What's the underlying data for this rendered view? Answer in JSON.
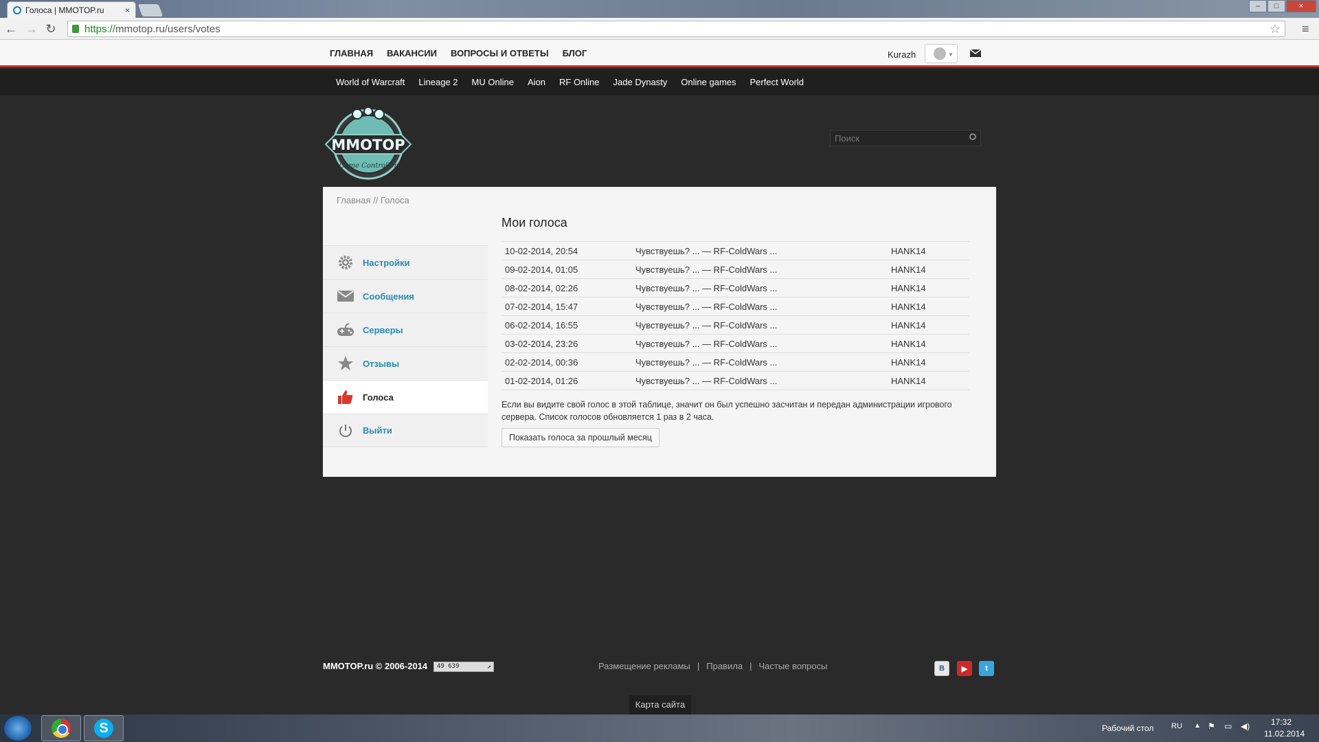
{
  "browser": {
    "tab_title": "Голоса | MMOTOP.ru",
    "tab_close": "×",
    "url_scheme": "https://",
    "url_rest": "mmotop.ru/users/votes"
  },
  "topnav": {
    "items": [
      "ГЛАВНАЯ",
      "ВАКАНСИИ",
      "ВОПРОСЫ И ОТВЕТЫ",
      "БЛОГ"
    ],
    "username": "Kurazh"
  },
  "gamenav": {
    "items": [
      "World of Warcraft",
      "Lineage 2",
      "MU Online",
      "Aion",
      "RF Online",
      "Jade Dynasty",
      "Online games",
      "Perfect World"
    ]
  },
  "logo": {
    "text": "MMOTOP",
    "subtitle": "Game Controller"
  },
  "search": {
    "placeholder": "Поиск"
  },
  "breadcrumb": "Главная // Голоса",
  "sidebar": {
    "items": [
      {
        "label": "Настройки",
        "icon": "gear-icon"
      },
      {
        "label": "Сообщения",
        "icon": "envelope-icon"
      },
      {
        "label": "Серверы",
        "icon": "gamepad-icon"
      },
      {
        "label": "Отзывы",
        "icon": "star-icon"
      },
      {
        "label": "Голоса",
        "icon": "thumbs-up-icon"
      },
      {
        "label": "Выйти",
        "icon": "power-icon"
      }
    ]
  },
  "main": {
    "title": "Мои голоса",
    "votes": [
      {
        "date": "10-02-2014, 20:54",
        "server": "Чувствуешь? ... — RF-ColdWars ...",
        "user": "HANK14"
      },
      {
        "date": "09-02-2014, 01:05",
        "server": "Чувствуешь? ... — RF-ColdWars ...",
        "user": "HANK14"
      },
      {
        "date": "08-02-2014, 02:26",
        "server": "Чувствуешь? ... — RF-ColdWars ...",
        "user": "HANK14"
      },
      {
        "date": "07-02-2014, 15:47",
        "server": "Чувствуешь? ... — RF-ColdWars ...",
        "user": "HANK14"
      },
      {
        "date": "06-02-2014, 16:55",
        "server": "Чувствуешь? ... — RF-ColdWars ...",
        "user": "HANK14"
      },
      {
        "date": "03-02-2014, 23:26",
        "server": "Чувствуешь? ... — RF-ColdWars ...",
        "user": "HANK14"
      },
      {
        "date": "02-02-2014, 00:36",
        "server": "Чувствуешь? ... — RF-ColdWars ...",
        "user": "HANK14"
      },
      {
        "date": "01-02-2014, 01:26",
        "server": "Чувствуешь? ... — RF-ColdWars ...",
        "user": "HANK14"
      }
    ],
    "note": "Если вы видите свой голос в этой таблице, значит он был успешно засчитан и передан администрации игрового сервера. Список голосов обновляется 1 раз в 2 часа.",
    "button_label": "Показать голоса за прошлый месяц"
  },
  "footer": {
    "copyright": "MMOTOP.ru © 2006-2014",
    "counter": "49 639",
    "links": [
      "Размещение рекламы",
      "Правила",
      "Частые вопросы"
    ],
    "separator": "|",
    "sitemap": "Карта сайта",
    "social": [
      {
        "icon": "vk-icon",
        "label": "B",
        "color": "#e8e8e8"
      },
      {
        "icon": "youtube-icon",
        "label": "▶",
        "color": "#cc2a2a"
      },
      {
        "icon": "twitter-icon",
        "label": "t",
        "color": "#3aa5dd"
      }
    ]
  },
  "taskbar": {
    "desktop_label": "Рабочий стол",
    "lang": "RU",
    "time": "17:32",
    "date": "11.02.2014"
  },
  "colors": {
    "accent_red": "#c0392b",
    "link_blue": "#2a8bb0"
  }
}
